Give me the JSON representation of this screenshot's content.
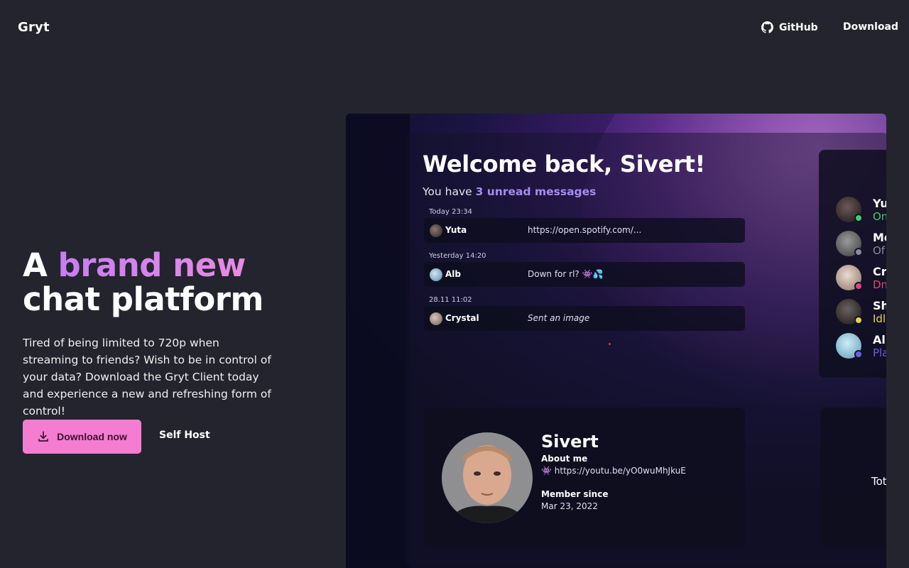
{
  "nav": {
    "logo": "Gryt",
    "github_label": "GitHub",
    "download_label": "Download",
    "github_icon": "github-icon"
  },
  "hero": {
    "title_line1_plain": "A ",
    "title_line1_accent": "brand new",
    "title_line2": "chat platform",
    "description": "Tired of being limited to 720p when streaming to friends? Wish to be in control of your data? Download the Gryt Client today and experience a new and refreshing form of control!",
    "primary_button": "Download now",
    "primary_icon": "download-icon",
    "secondary_button": "Self Host",
    "accent_color": "#d58bf0",
    "button_color": "#f47dd1"
  },
  "preview": {
    "welcome": "Welcome back, Sivert!",
    "unread_prefix": "You have ",
    "unread_highlight": "3 unread messages",
    "messages": [
      {
        "date": "Today 23:34",
        "name": "Yuta",
        "text": "https://open.spotify.com/..."
      },
      {
        "date": "Yesterday 14:20",
        "name": "Alb",
        "text": "Down for rl? 👾💦"
      },
      {
        "date": "28.11 11:02",
        "name": "Crystal",
        "text": "Sent an image"
      }
    ],
    "friends": [
      {
        "name": "Yu",
        "sub": "On",
        "sub_color": "#3ecf6b",
        "status_color": "#3ecf6b"
      },
      {
        "name": "Me",
        "sub": "Of",
        "sub_color": "#8a8a9a",
        "status_color": "#8a8a9a"
      },
      {
        "name": "Cr",
        "sub": "Dn",
        "sub_color": "#e0457a",
        "status_color": "#e0457a"
      },
      {
        "name": "Sh",
        "sub": "Idl",
        "sub_color": "#e8d44a",
        "status_color": "#e8d44a"
      },
      {
        "name": "Al",
        "sub": "Pla",
        "sub_color": "#6f5fe0",
        "status_color": "#6f5fe0"
      }
    ],
    "profile": {
      "name": "Sivert",
      "about_label": "About me",
      "about_value": "👾 https://youtu.be/yO0wuMhJkuE",
      "member_label": "Member since",
      "member_value": "Mar 23, 2022"
    },
    "stats_label": "Tot"
  }
}
